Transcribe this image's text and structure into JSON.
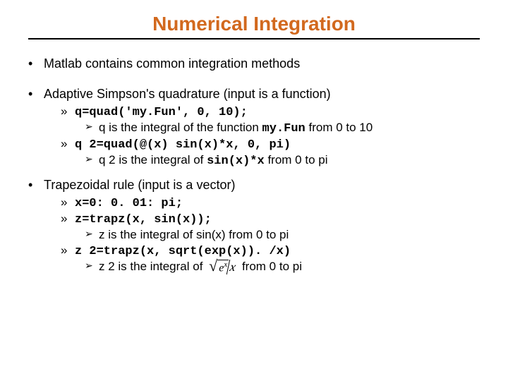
{
  "title": "Numerical Integration",
  "b1a": "Matlab contains common integration methods",
  "b1b": "Adaptive Simpson's quadrature (input is a function)",
  "b1c": "Trapezoidal rule (input is a vector)",
  "code_q": "q=quad('my.Fun', 0, 10);",
  "q_desc_pre": "q is the integral of the function ",
  "q_desc_code": "my.Fun",
  "q_desc_post": " from 0 to 10",
  "code_q2": "q 2=quad(@(x) sin(x)*x, 0, pi)",
  "q2_desc_pre": "q 2 is the integral of ",
  "q2_desc_code": "sin(x)*x",
  "q2_desc_post": " from 0 to pi",
  "code_x": "x=0: 0. 01: pi;",
  "code_z": "z=trapz(x, sin(x));",
  "z_desc": "z is the integral of sin(x) from 0 to pi",
  "code_z2": "z 2=trapz(x, sqrt(exp(x)). /x)",
  "z2_desc_pre": "z 2 is the integral of ",
  "z2_desc_post": " from 0 to pi",
  "formula_base": "e",
  "formula_exp": "x",
  "formula_div": "x"
}
